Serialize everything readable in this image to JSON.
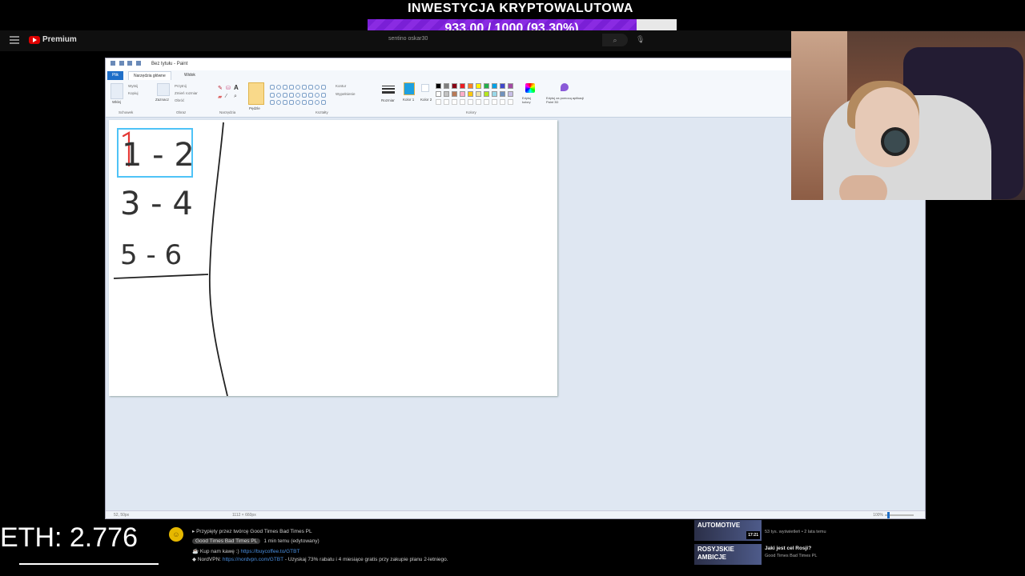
{
  "goal": {
    "title": "INWESTYCJA KRYPTOWALUTOWA",
    "progress_text": "933.00 / 1000 (93.30%)",
    "progress_fraction": 0.933,
    "fill_color": "#7a1fd6"
  },
  "youtube": {
    "logo_text": "Premium",
    "search_value": "sentino oskar30",
    "search_icon": "search-icon",
    "mic_icon": "microphone-icon"
  },
  "paint": {
    "window_title": "Bez tytułu - Paint",
    "tabs": [
      "Plik",
      "Narzędzia główne",
      "Widok"
    ],
    "ribbon_groups": [
      "Schowek",
      "Obraz",
      "Narzędzia",
      "Kształty",
      "Kolory"
    ],
    "ribbon_buttons": {
      "paste": "Wklej",
      "cut": "Wytnij",
      "copy": "Kopiuj",
      "select": "Zaznacz",
      "crop": "Przytnij",
      "resize": "Zmień rozmiar",
      "rotate": "Obróć",
      "brushes": "Pędzle",
      "outline": "Kontur",
      "fill": "Wypełnienie",
      "size": "Rozmiar",
      "color1": "Kolor 1",
      "color2": "Kolor 2",
      "edit_colors": "Edytuj kolory",
      "paint3d": "Edytuj za pomocą aplikacji Paint 3D"
    },
    "palette": [
      "#000000",
      "#7f7f7f",
      "#880015",
      "#ed1c24",
      "#ff7f27",
      "#fff200",
      "#22b14c",
      "#00a2e8",
      "#3f48cc",
      "#a349a4",
      "#ffffff",
      "#c3c3c3",
      "#b97a57",
      "#ffaec9",
      "#ffc90e",
      "#efe4b0",
      "#b5e61d",
      "#99d9ea",
      "#7092be",
      "#c8bfe7"
    ],
    "active_color": "#1ea0e0",
    "drawing": {
      "lines": [
        "1 - 2",
        "3 - 4",
        "5 - 6"
      ],
      "highlight_color": "#4fc3f7",
      "accent_color": "#e53935"
    },
    "status": {
      "position": "52, 50px",
      "canvas_size": "1112 × 660px",
      "zoom": "100%"
    }
  },
  "overlay": {
    "eth_label": "ETH: 2.776"
  },
  "chat": {
    "pinned": "Przypięty przez twórcę Good Times Bad Times PL",
    "author_badge": "Good Times Bad Times PL",
    "author_meta": "1 min temu (edytowany)",
    "line1_text": "Kup nam kawę :)",
    "line1_link": "https://buycoffee.to/GTBT",
    "line2_text": "NordVPN:",
    "line2_link": "https://nordvpn.com/GTBT",
    "line2_rest": "- Uzyskaj 73% rabatu i 4 miesiące gratis przy zakupie planu 2-letniego."
  },
  "related": [
    {
      "thumb_text": "AUTOMOTIVE",
      "duration": "17:21",
      "title": "",
      "meta": "53 tys. wyświetleń • 2 lata temu"
    },
    {
      "thumb_text": "ROSYJSKIE AMBICJE",
      "duration": "",
      "title": "Jaki jest cel Rosji?",
      "meta": "Good Times Bad Times PL"
    }
  ]
}
